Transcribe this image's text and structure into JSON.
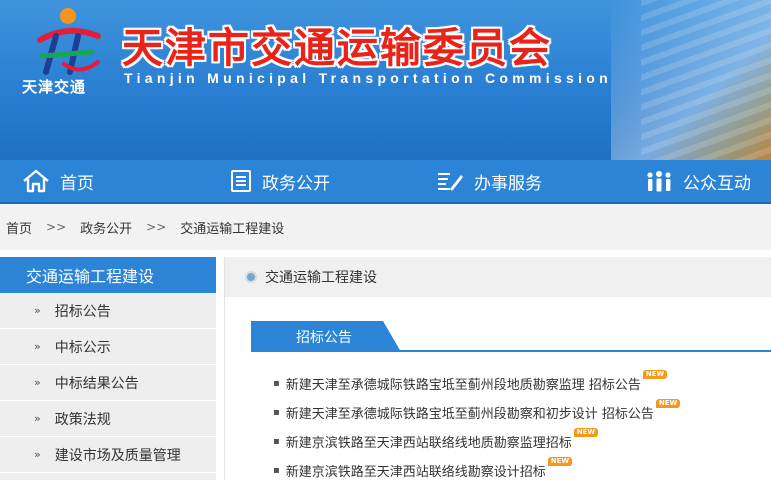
{
  "header": {
    "logo_caption": "天津交通",
    "title_cn": "天津市交通运输委员会",
    "title_en": "Tianjin Municipal Transportation Commission"
  },
  "nav": {
    "items": [
      {
        "label": "首页",
        "icon": "home-icon"
      },
      {
        "label": "政务公开",
        "icon": "document-icon"
      },
      {
        "label": "办事服务",
        "icon": "edit-icon"
      },
      {
        "label": "公众互动",
        "icon": "people-icon"
      }
    ]
  },
  "breadcrumb": {
    "items": [
      "首页",
      "政务公开",
      "交通运输工程建设"
    ],
    "separator": ">>"
  },
  "sidebar": {
    "title": "交通运输工程建设",
    "arrow": "»",
    "items": [
      {
        "label": "招标公告"
      },
      {
        "label": "中标公示"
      },
      {
        "label": "中标结果公告"
      },
      {
        "label": "政策法规"
      },
      {
        "label": "建设市场及质量管理"
      }
    ]
  },
  "main": {
    "title": "交通运输工程建设",
    "tab_label": "招标公告",
    "bullet": "▪",
    "badge_text": "NEW",
    "items": [
      {
        "text": "新建天津至承德城际铁路宝坻至蓟州段地质勘察监理 招标公告"
      },
      {
        "text": "新建天津至承德城际铁路宝坻至蓟州段勘察和初步设计 招标公告"
      },
      {
        "text": "新建京滨铁路至天津西站联络线地质勘察监理招标"
      },
      {
        "text": "新建京滨铁路至天津西站联络线勘察设计招标"
      }
    ]
  },
  "colors": {
    "primary_blue": "#2c84d6",
    "title_red": "#e8241a",
    "badge_orange": "#f39a1c"
  }
}
